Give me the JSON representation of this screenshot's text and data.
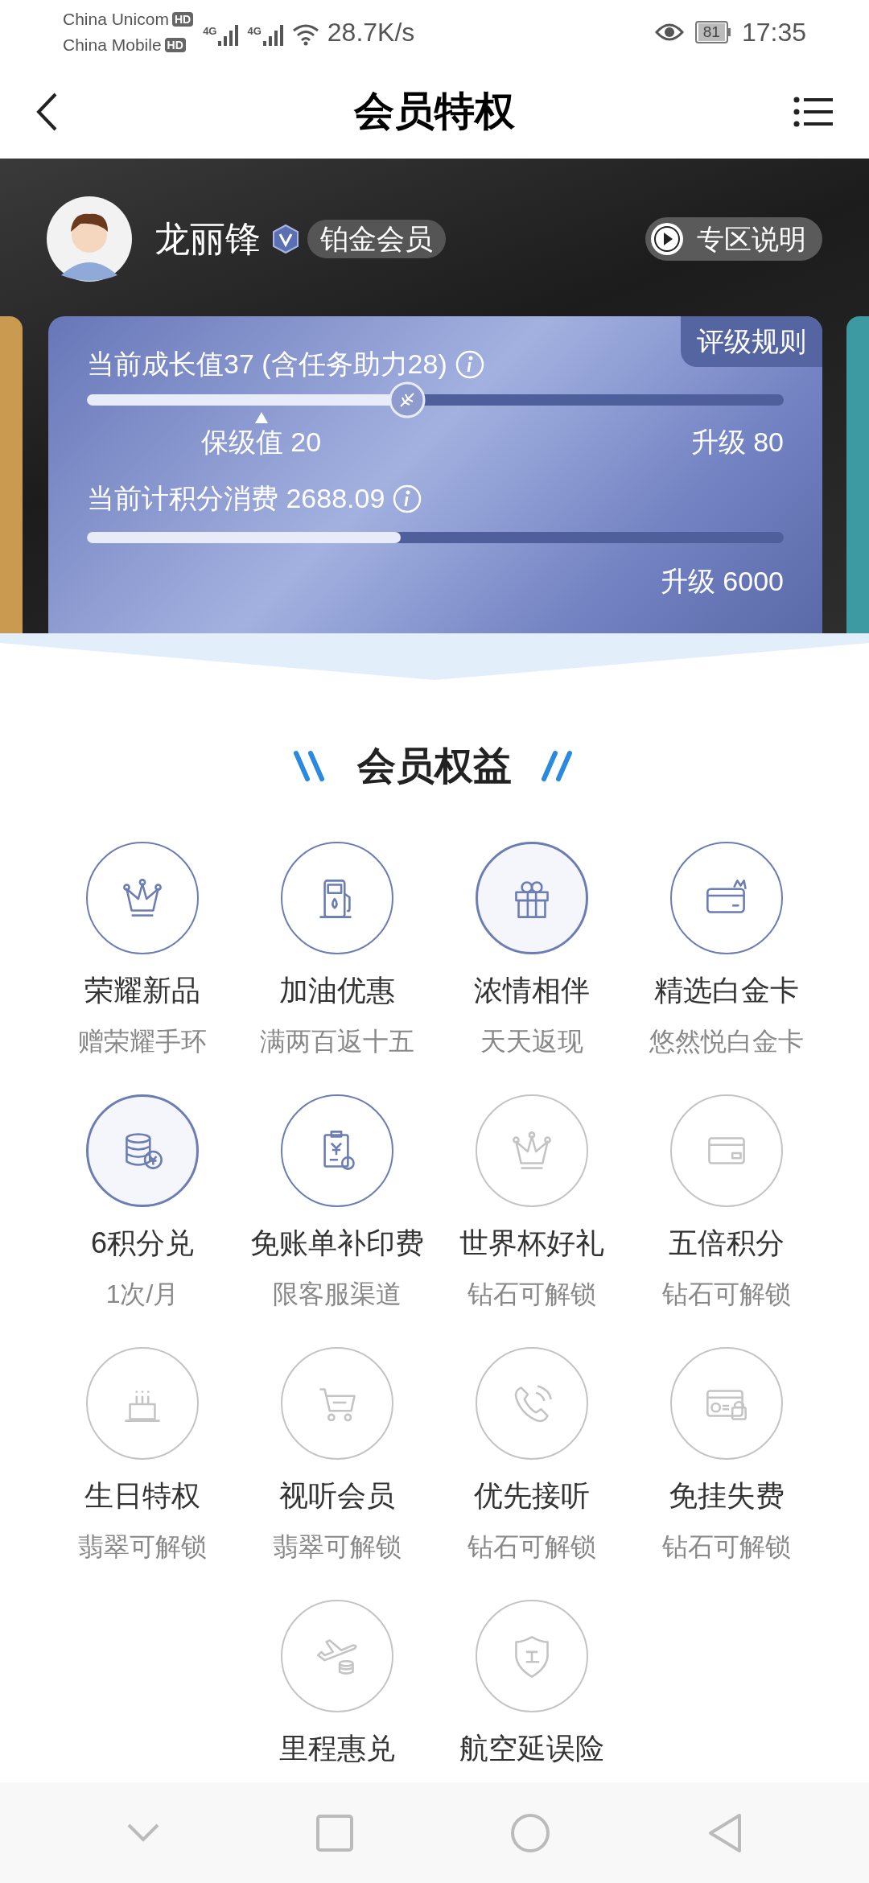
{
  "status_bar": {
    "carriers": [
      "China Unicom",
      "China Mobile"
    ],
    "hd_badges": [
      "HD",
      "HD"
    ],
    "network": [
      "4G",
      "4G"
    ],
    "speed": "28.7K/s",
    "battery": "81",
    "time": "17:35"
  },
  "header": {
    "title": "会员特权"
  },
  "profile": {
    "name": "龙丽锋",
    "tier": "铂金会员",
    "info_button": "专区说明"
  },
  "card": {
    "rules_tab": "评级规则",
    "growth": {
      "label": "当前成长值37 (含任务助力28)",
      "level": 0.46,
      "protection": {
        "label": "保级值 20",
        "level": 0.25
      },
      "upgrade": "升级 80"
    },
    "spending": {
      "label": "当前计积分消费 2688.09",
      "level": 0.45,
      "upgrade": "升级 6000"
    }
  },
  "section_title": "会员权益",
  "benefits": [
    {
      "title": "荣耀新品",
      "subtitle": "赠荣耀手环",
      "locked": false,
      "highlighted": false
    },
    {
      "title": "加油优惠",
      "subtitle": "满两百返十五",
      "locked": false,
      "highlighted": false
    },
    {
      "title": "浓情相伴",
      "subtitle": "天天返现",
      "locked": false,
      "highlighted": true
    },
    {
      "title": "精选白金卡",
      "subtitle": "悠然悦白金卡",
      "locked": false,
      "highlighted": false
    },
    {
      "title": "6积分兑",
      "subtitle": "1次/月",
      "locked": false,
      "highlighted": true
    },
    {
      "title": "免账单补印费",
      "subtitle": "限客服渠道",
      "locked": false,
      "highlighted": false
    },
    {
      "title": "世界杯好礼",
      "subtitle": "钻石可解锁",
      "locked": true,
      "highlighted": false
    },
    {
      "title": "五倍积分",
      "subtitle": "钻石可解锁",
      "locked": true,
      "highlighted": false
    },
    {
      "title": "生日特权",
      "subtitle": "翡翠可解锁",
      "locked": true,
      "highlighted": false
    },
    {
      "title": "视听会员",
      "subtitle": "翡翠可解锁",
      "locked": true,
      "highlighted": false
    },
    {
      "title": "优先接听",
      "subtitle": "钻石可解锁",
      "locked": true,
      "highlighted": false
    },
    {
      "title": "免挂失费",
      "subtitle": "钻石可解锁",
      "locked": true,
      "highlighted": false
    },
    {
      "title": "里程惠兑",
      "locked": true,
      "highlighted": false
    },
    {
      "title": "航空延误险",
      "locked": true,
      "highlighted": false
    }
  ]
}
